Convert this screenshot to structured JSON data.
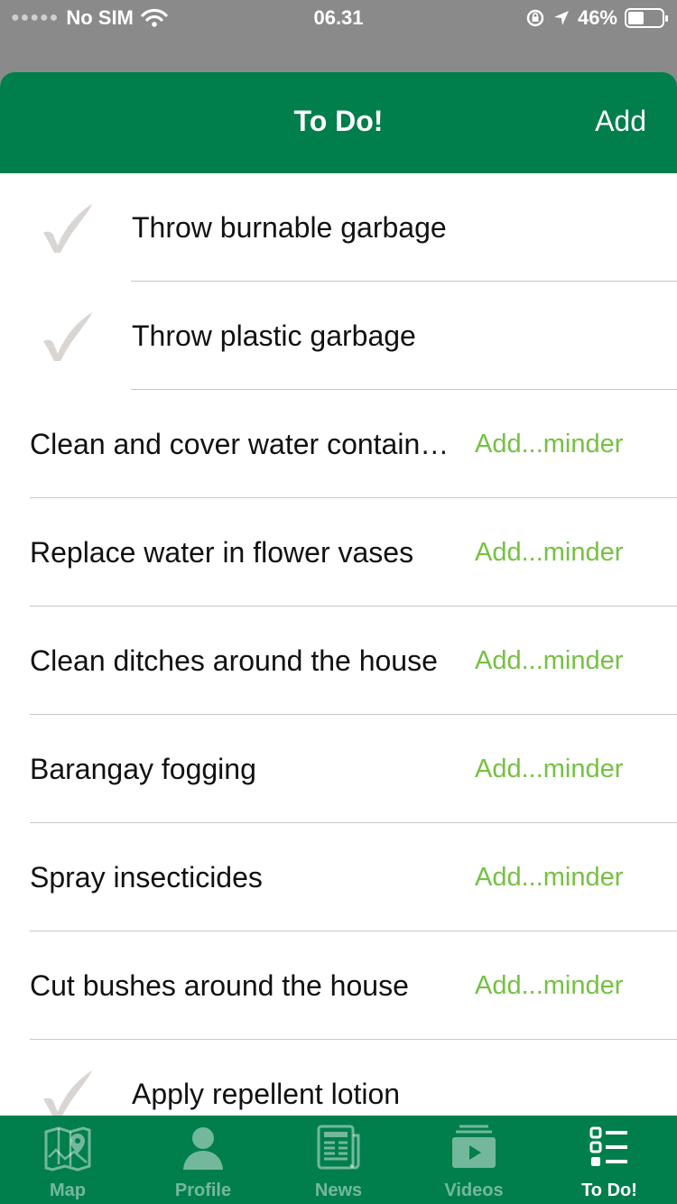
{
  "status_bar": {
    "carrier": "No SIM",
    "time": "06.31",
    "battery": "46%",
    "battery_level": 0.46
  },
  "nav": {
    "title": "To Do!",
    "add_label": "Add"
  },
  "todos": [
    {
      "label": "Throw burnable garbage",
      "done": true
    },
    {
      "label": "Throw plastic garbage",
      "done": true
    },
    {
      "label": "Clean and cover water containers",
      "done": false,
      "reminder": "Add...minder"
    },
    {
      "label": "Replace water in flower vases",
      "done": false,
      "reminder": "Add...minder"
    },
    {
      "label": "Clean ditches around the house",
      "done": false,
      "reminder": "Add...minder"
    },
    {
      "label": "Barangay fogging",
      "done": false,
      "reminder": "Add...minder"
    },
    {
      "label": "Spray insecticides",
      "done": false,
      "reminder": "Add...minder"
    },
    {
      "label": "Cut bushes around the house",
      "done": false,
      "reminder": "Add...minder"
    },
    {
      "label": "Apply repellent lotion",
      "done": true
    }
  ],
  "tabs": [
    {
      "label": "Map",
      "icon": "map-icon",
      "active": false
    },
    {
      "label": "Profile",
      "icon": "profile-icon",
      "active": false
    },
    {
      "label": "News",
      "icon": "news-icon",
      "active": false
    },
    {
      "label": "Videos",
      "icon": "videos-icon",
      "active": false
    },
    {
      "label": "To Do!",
      "icon": "todo-list-icon",
      "active": true
    }
  ],
  "colors": {
    "brand_green": "#007e4c",
    "reminder_green": "#76c043",
    "check_gray": "#d9d5d3"
  }
}
